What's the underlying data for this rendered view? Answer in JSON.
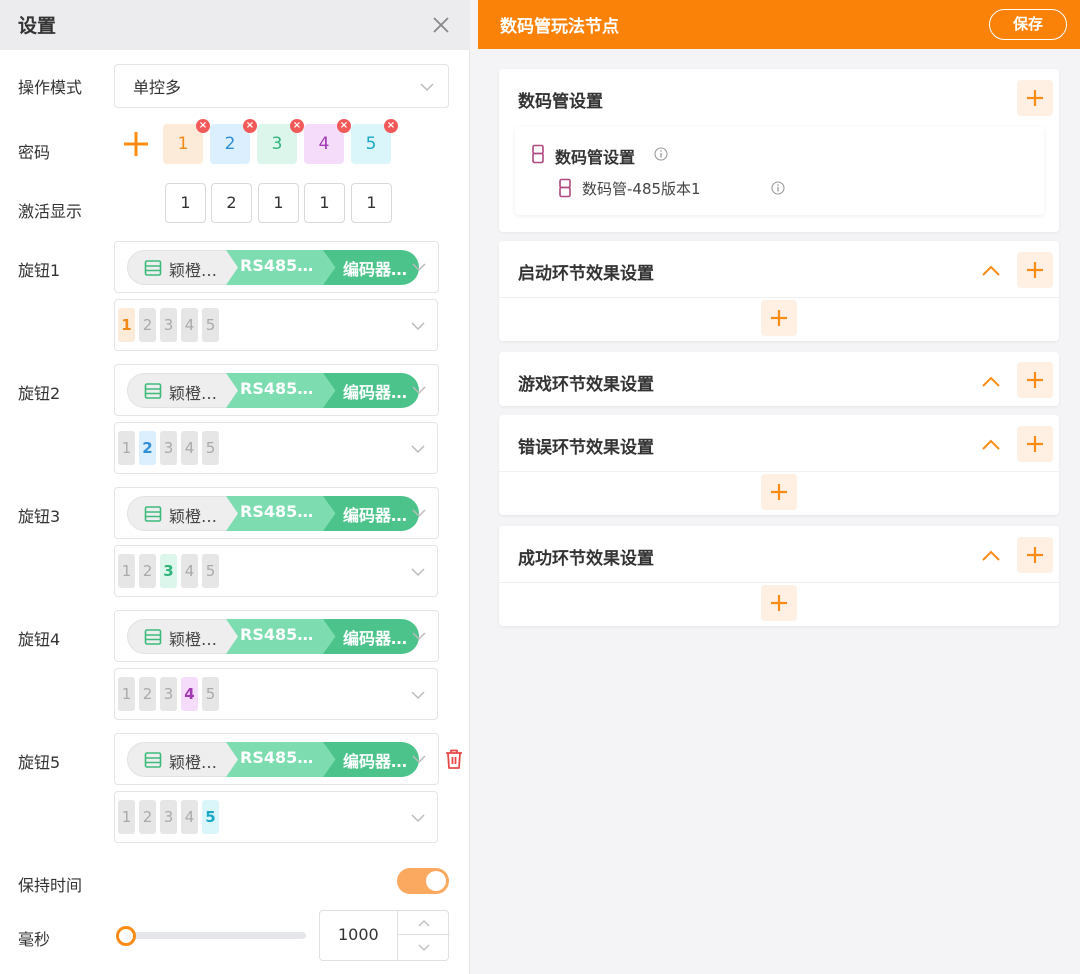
{
  "left": {
    "title": "设置",
    "mode": {
      "label": "操作模式",
      "value": "单控多"
    },
    "password": {
      "label": "密码",
      "chips": [
        {
          "text": "1",
          "bg": "#fdebd9",
          "fg": "#f28a1a"
        },
        {
          "text": "2",
          "bg": "#dcefff",
          "fg": "#2f8fd8"
        },
        {
          "text": "3",
          "bg": "#dcf6eb",
          "fg": "#2fb57a"
        },
        {
          "text": "4",
          "bg": "#f5dcfb",
          "fg": "#a23ab6"
        },
        {
          "text": "5",
          "bg": "#dbf6fb",
          "fg": "#19a8c8"
        }
      ]
    },
    "activation": {
      "label": "激活显示",
      "values": [
        "1",
        "2",
        "1",
        "1",
        "1"
      ]
    },
    "knobs": [
      {
        "label": "旋钮1",
        "seg1": "颖橙…",
        "seg2": "RS485…",
        "seg3": "编码器…",
        "options": [
          "1",
          "2",
          "3",
          "4",
          "5"
        ],
        "selected": 0,
        "sel_bg": "#fdebd9",
        "sel_fg": "#f28a1a"
      },
      {
        "label": "旋钮2",
        "seg1": "颖橙…",
        "seg2": "RS485…",
        "seg3": "编码器…",
        "options": [
          "1",
          "2",
          "3",
          "4",
          "5"
        ],
        "selected": 1,
        "sel_bg": "#dcefff",
        "sel_fg": "#2f8fd8"
      },
      {
        "label": "旋钮3",
        "seg1": "颖橙…",
        "seg2": "RS485…",
        "seg3": "编码器…",
        "options": [
          "1",
          "2",
          "3",
          "4",
          "5"
        ],
        "selected": 2,
        "sel_bg": "#dcf6eb",
        "sel_fg": "#2fb57a"
      },
      {
        "label": "旋钮4",
        "seg1": "颖橙…",
        "seg2": "RS485…",
        "seg3": "编码器…",
        "options": [
          "1",
          "2",
          "3",
          "4",
          "5"
        ],
        "selected": 3,
        "sel_bg": "#f5dcfb",
        "sel_fg": "#a23ab6"
      },
      {
        "label": "旋钮5",
        "seg1": "颖橙…",
        "seg2": "RS485…",
        "seg3": "编码器…",
        "options": [
          "1",
          "2",
          "3",
          "4",
          "5"
        ],
        "selected": 4,
        "sel_bg": "#dbf6fb",
        "sel_fg": "#19a8c8"
      }
    ],
    "hold_time": {
      "label": "保持时间",
      "enabled": true
    },
    "ms": {
      "label": "毫秒",
      "value": "1000",
      "slider_fraction": 0
    }
  },
  "right": {
    "title": "数码管玩法节点",
    "save_label": "保存",
    "segment_card": {
      "title": "数码管设置",
      "tree_parent": "数码管设置",
      "tree_child": "数码管-485版本1"
    },
    "cards": [
      {
        "title": "启动环节效果设置",
        "has_body": true
      },
      {
        "title": "游戏环节效果设置",
        "has_body": false
      },
      {
        "title": "错误环节效果设置",
        "has_body": true
      },
      {
        "title": "成功环节效果设置",
        "has_body": true
      }
    ]
  },
  "colors": {
    "accent": "#fa8209",
    "plus_bg": "#fff0e3",
    "danger": "#e84a4a",
    "green_light": "#7dddb0",
    "green_dark": "#4cc38a",
    "segment_icon": "#b0477e"
  }
}
